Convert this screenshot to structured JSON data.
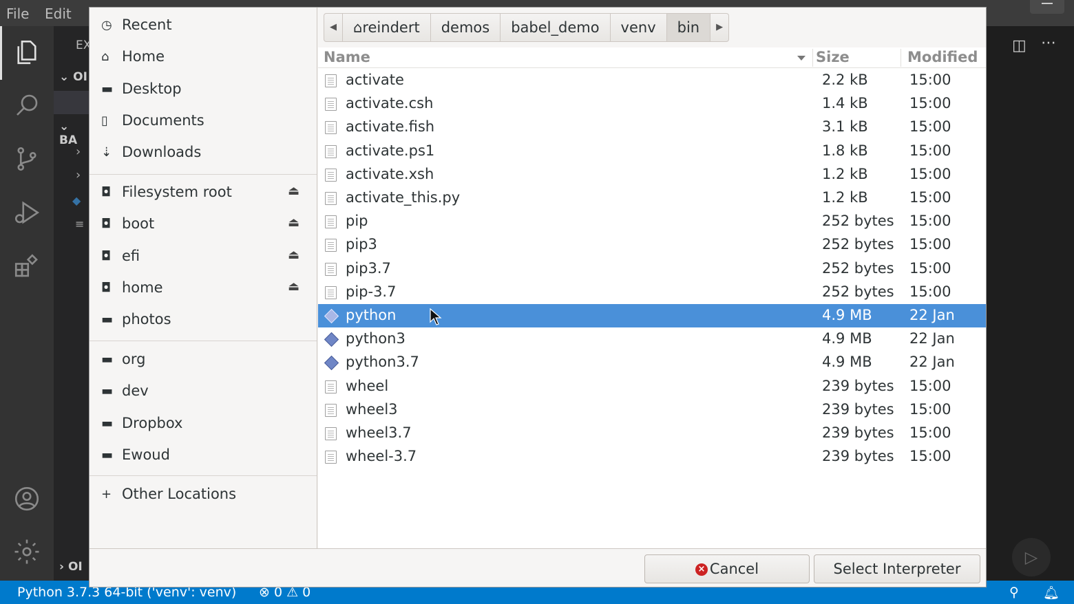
{
  "menubar": {
    "file": "File",
    "edit": "Edit"
  },
  "sidebar_fragments": {
    "explorer": "EX",
    "section1": "OI",
    "section2": "BA",
    "section3": "OI"
  },
  "statusbar": {
    "interpreter": "Python 3.7.3 64-bit ('venv': venv)",
    "problems": "⊗ 0 ⚠ 0"
  },
  "dialog": {
    "places": {
      "group1": [
        {
          "label": "Recent",
          "icon": "clock-icon"
        },
        {
          "label": "Home",
          "icon": "home-icon"
        },
        {
          "label": "Desktop",
          "icon": "folder-icon"
        },
        {
          "label": "Documents",
          "icon": "document-icon"
        },
        {
          "label": "Downloads",
          "icon": "download-icon"
        }
      ],
      "group2": [
        {
          "label": "Filesystem root",
          "icon": "drive-icon",
          "eject": true
        },
        {
          "label": "boot",
          "icon": "drive-icon",
          "eject": true
        },
        {
          "label": "efi",
          "icon": "drive-icon",
          "eject": true
        },
        {
          "label": "home",
          "icon": "drive-icon",
          "eject": true
        },
        {
          "label": "photos",
          "icon": "disk-icon",
          "eject": false
        }
      ],
      "group3": [
        {
          "label": "org",
          "icon": "folder-icon"
        },
        {
          "label": "dev",
          "icon": "folder-icon"
        },
        {
          "label": "Dropbox",
          "icon": "folder-icon"
        },
        {
          "label": "Ewoud",
          "icon": "folder-icon"
        }
      ],
      "other": {
        "label": "Other Locations",
        "icon": "plus-icon"
      }
    },
    "pathbar": [
      "reindert",
      "demos",
      "babel_demo",
      "venv",
      "bin"
    ],
    "columns": {
      "name": "Name",
      "size": "Size",
      "modified": "Modified"
    },
    "files": [
      {
        "name": "activate",
        "size": "2.2 kB",
        "modified": "15:00",
        "type": "text"
      },
      {
        "name": "activate.csh",
        "size": "1.4 kB",
        "modified": "15:00",
        "type": "text"
      },
      {
        "name": "activate.fish",
        "size": "3.1 kB",
        "modified": "15:00",
        "type": "text"
      },
      {
        "name": "activate.ps1",
        "size": "1.8 kB",
        "modified": "15:00",
        "type": "text"
      },
      {
        "name": "activate.xsh",
        "size": "1.2 kB",
        "modified": "15:00",
        "type": "text"
      },
      {
        "name": "activate_this.py",
        "size": "1.2 kB",
        "modified": "15:00",
        "type": "text"
      },
      {
        "name": "pip",
        "size": "252 bytes",
        "modified": "15:00",
        "type": "text"
      },
      {
        "name": "pip3",
        "size": "252 bytes",
        "modified": "15:00",
        "type": "text"
      },
      {
        "name": "pip3.7",
        "size": "252 bytes",
        "modified": "15:00",
        "type": "text"
      },
      {
        "name": "pip-3.7",
        "size": "252 bytes",
        "modified": "15:00",
        "type": "text"
      },
      {
        "name": "python",
        "size": "4.9 MB",
        "modified": "22 Jan",
        "type": "executable",
        "selected": true
      },
      {
        "name": "python3",
        "size": "4.9 MB",
        "modified": "22 Jan",
        "type": "executable"
      },
      {
        "name": "python3.7",
        "size": "4.9 MB",
        "modified": "22 Jan",
        "type": "executable"
      },
      {
        "name": "wheel",
        "size": "239 bytes",
        "modified": "15:00",
        "type": "text"
      },
      {
        "name": "wheel3",
        "size": "239 bytes",
        "modified": "15:00",
        "type": "text"
      },
      {
        "name": "wheel3.7",
        "size": "239 bytes",
        "modified": "15:00",
        "type": "text"
      },
      {
        "name": "wheel-3.7",
        "size": "239 bytes",
        "modified": "15:00",
        "type": "text"
      }
    ],
    "buttons": {
      "cancel": "Cancel",
      "select": "Select Interpreter"
    }
  },
  "colors": {
    "selection": "#4a90d9",
    "statusbar": "#007acc",
    "cancel_icon": "#cc2222"
  }
}
